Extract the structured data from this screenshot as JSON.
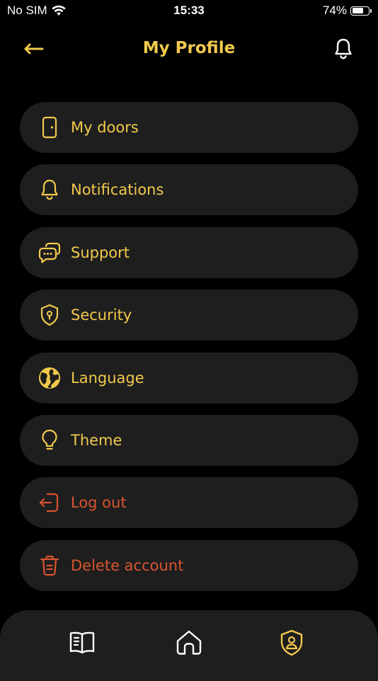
{
  "status_bar": {
    "carrier": "No SIM",
    "time": "15:33",
    "battery_percent": "74%",
    "battery_level": 0.74
  },
  "header": {
    "title": "My Profile",
    "back_icon": "arrow-left-icon",
    "bell_icon": "bell-icon"
  },
  "menu": {
    "items": [
      {
        "label": "My doors",
        "icon": "door-icon"
      },
      {
        "label": "Notifications",
        "icon": "bell-icon"
      },
      {
        "label": "Support",
        "icon": "chat-icon"
      },
      {
        "label": "Security",
        "icon": "shield-lock-icon"
      },
      {
        "label": "Language",
        "icon": "globe-icon"
      },
      {
        "label": "Theme",
        "icon": "lightbulb-icon"
      },
      {
        "label": "Log out",
        "icon": "logout-icon"
      },
      {
        "label": "Delete account",
        "icon": "trash-icon"
      }
    ]
  },
  "tab_bar": {
    "tabs": [
      {
        "name": "book",
        "icon": "book-icon",
        "active": false
      },
      {
        "name": "home",
        "icon": "home-icon",
        "active": false
      },
      {
        "name": "profile",
        "icon": "profile-shield-icon",
        "active": true
      }
    ]
  },
  "colors": {
    "accent": "#f2c94c",
    "danger": "#d9542f",
    "surface": "#1e1e1e",
    "background": "#000000",
    "tab_inactive": "#ffffff"
  }
}
